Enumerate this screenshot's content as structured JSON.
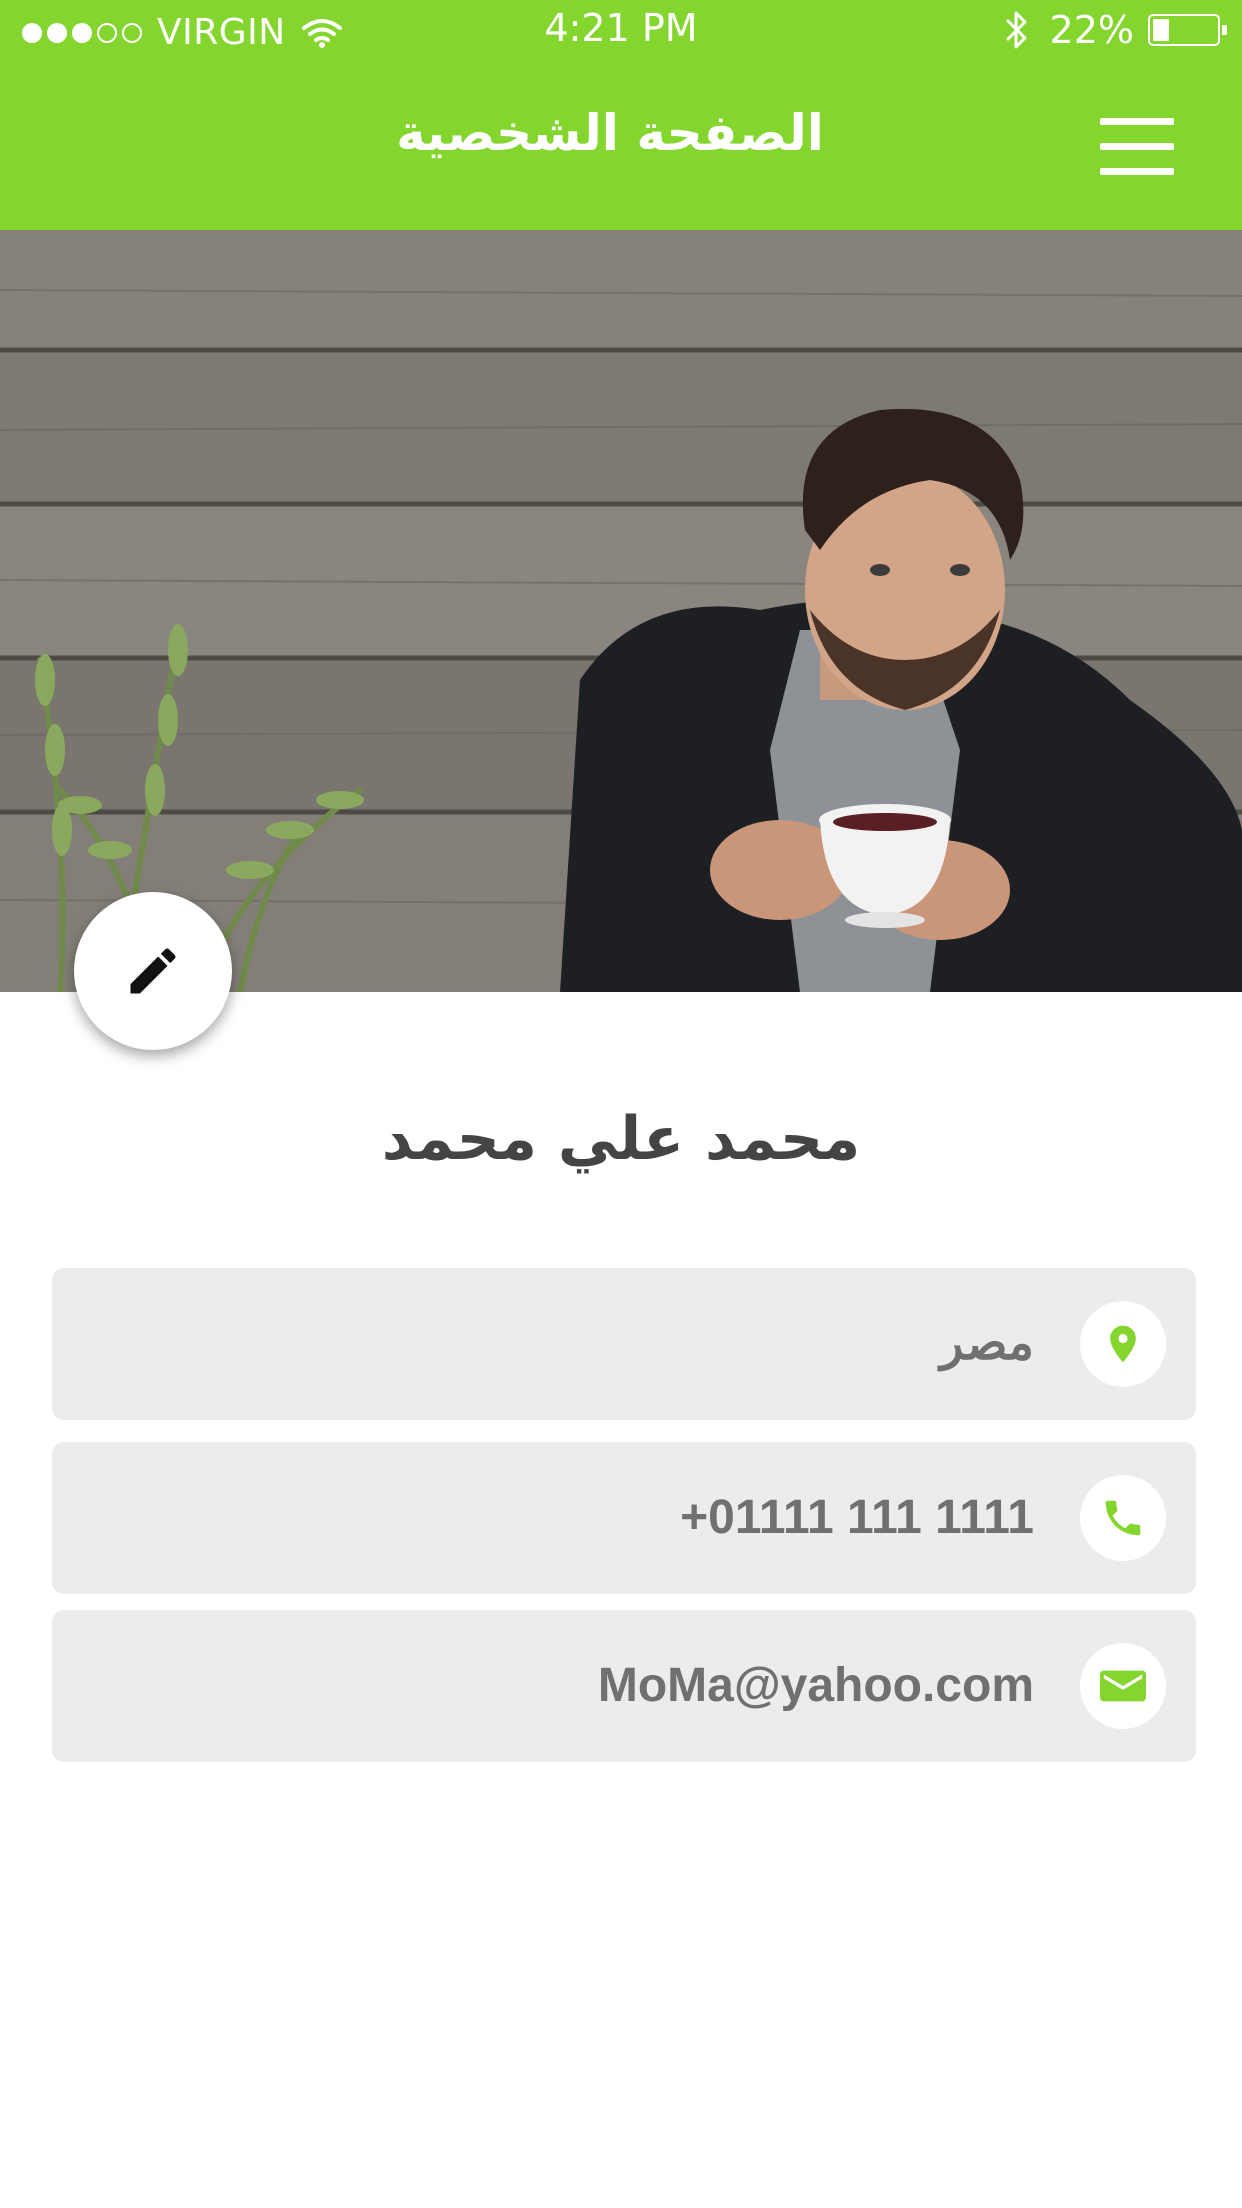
{
  "status_bar": {
    "carrier": "VIRGIN",
    "time": "4:21 PM",
    "battery": "22%",
    "signal_bars_filled": 3,
    "signal_bars_total": 5
  },
  "app_bar": {
    "title": "الصفحة الشخصية",
    "menu_icon": "hamburger-menu-icon"
  },
  "profile": {
    "name": "محمد علي محمد",
    "edit_icon": "pencil-icon"
  },
  "info": [
    {
      "icon": "location-pin-icon",
      "value": "مصر"
    },
    {
      "icon": "phone-icon",
      "value": "+01111 111 1111"
    },
    {
      "icon": "email-icon",
      "value": "MoMa@yahoo.com"
    }
  ],
  "colors": {
    "accent": "#84d62f",
    "card_bg": "#ececec",
    "text_dark": "#444444",
    "text_value": "#707070"
  }
}
